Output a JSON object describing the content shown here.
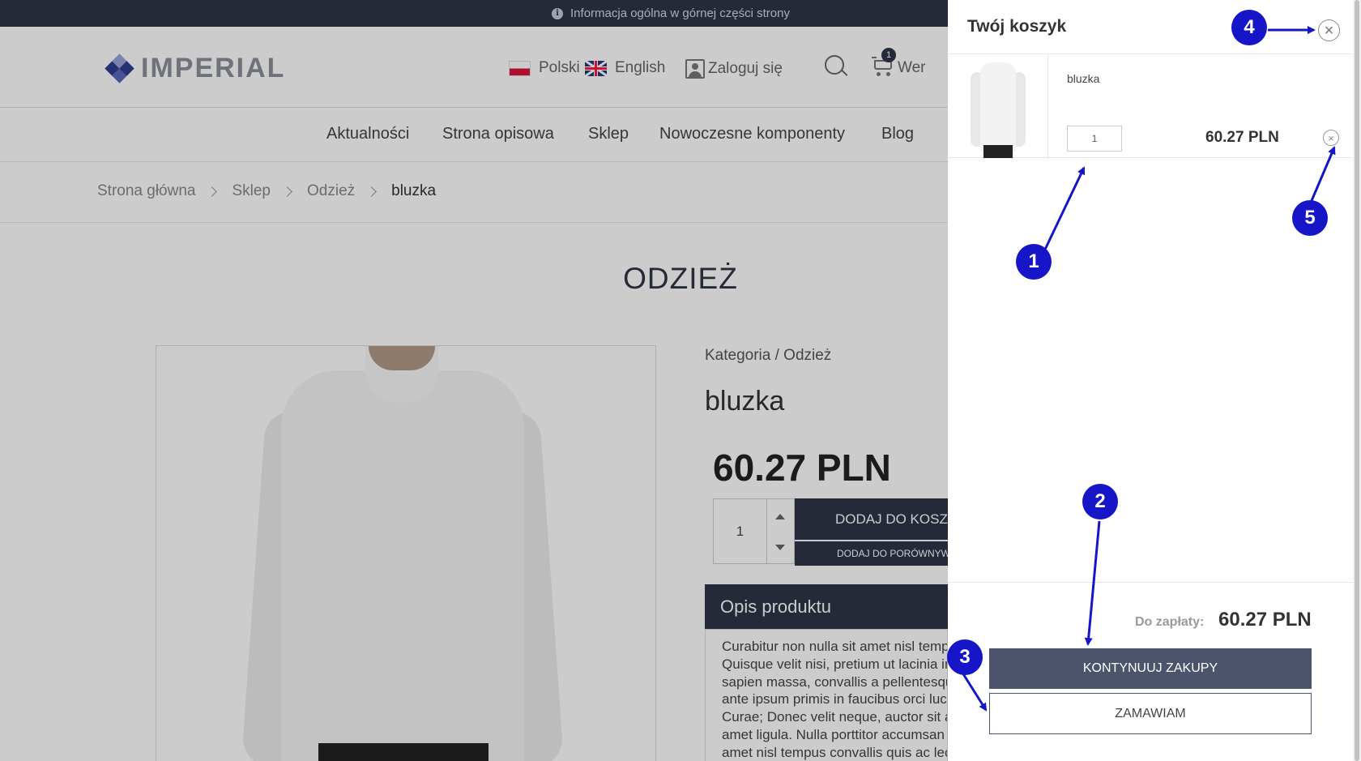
{
  "topbar": {
    "info_text": "Informacja ogólna w górnej części strony",
    "icon": "info-icon"
  },
  "header": {
    "logo_text": "IMPERIAL",
    "lang_pl": "Polski",
    "lang_en": "English",
    "login": "Zaloguj się",
    "cart_count": "1",
    "cut_text": "Wer"
  },
  "nav": {
    "items": [
      "Aktualności",
      "Strona opisowa",
      "Sklep",
      "Nowoczesne komponenty",
      "Blog"
    ]
  },
  "breadcrumb": {
    "items": [
      "Strona główna",
      "Sklep",
      "Odzież"
    ],
    "current": "bluzka"
  },
  "page": {
    "title": "ODZIEŻ"
  },
  "product": {
    "category": "Kategoria / Odzież",
    "name": "bluzka",
    "price": "60.27 PLN",
    "qty": "1",
    "add_to_cart": "DODAJ DO KOSZYKA",
    "add_to_compare": "DODAJ DO PORÓWNYWARKI",
    "desc_title": "Opis produktu",
    "desc_lines": [
      "Curabitur non nulla sit amet nisl tempus",
      "Quisque velit nisi, pretium ut lacinia in,",
      "sapien massa, convallis a pellentesque nec,",
      "ante ipsum primis in faucibus orci luctus et",
      "Curae; Donec velit neque, auctor sit amet",
      "amet ligula. Nulla porttitor accumsan tincidunt.",
      "amet nisl tempus convallis quis ac lectus."
    ]
  },
  "cart": {
    "title": "Twój koszyk",
    "item": {
      "name": "bluzka",
      "qty": "1",
      "price": "60.27 PLN"
    },
    "total_label": "Do zapłaty:",
    "total_value": "60.27 PLN",
    "continue_label": "KONTYNUUJ ZAKUPY",
    "order_label": "ZAMAWIAM"
  },
  "annotations": {
    "color": "#1616c8",
    "labels": [
      "1",
      "2",
      "3",
      "4",
      "5"
    ]
  }
}
